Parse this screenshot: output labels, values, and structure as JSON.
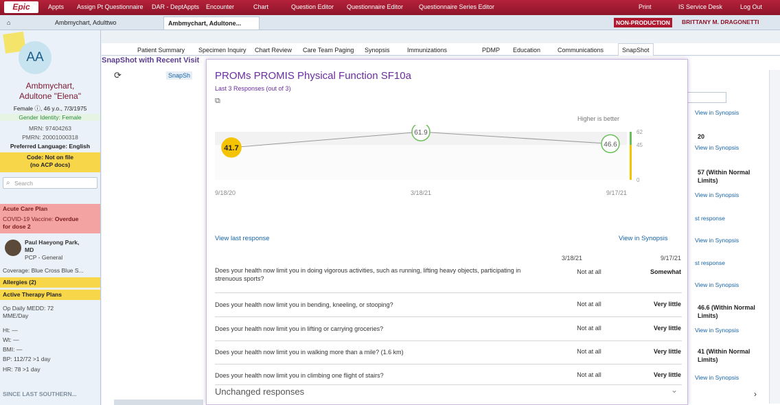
{
  "topbar": {
    "brand": "Epic",
    "items": [
      "Appts",
      "Assign Pt Questionnaire",
      "DAR - DeptAppts",
      "Encounter",
      "Chart",
      "Question Editor",
      "Questionnaire Editor",
      "Questionnaire Series Editor"
    ],
    "right": [
      "Print",
      "IS Service Desk",
      "Log Out"
    ]
  },
  "window_tabs": [
    "Ambmychart, Adulttwo",
    "Ambmychart, Adultone..."
  ],
  "environment_badge": "NON-PRODUCTION",
  "user_name": "BRITTANY M. DRAGONETTI",
  "patient": {
    "initials": "AA",
    "name_line1": "Ambmychart,",
    "name_line2": "Adultone \"Elena\"",
    "demographics": "Female ⓘ, 46 y.o., 7/3/1975",
    "gender_identity": "Gender Identity: Female",
    "mrn": "MRN: 97404263",
    "pmrn": "PMRN: 20001000318",
    "language": "Preferred Language: English",
    "code_line1": "Code: Not on file",
    "code_line2": "(no ACP docs)",
    "search_placeholder": "Search",
    "acute_care": "Acute Care Plan",
    "covid_label": "COVID-19 Vaccine:",
    "covid_status": "Overdue",
    "covid_dose": "for dose 2",
    "pcp_line1": "Paul Haeyong Park,",
    "pcp_line2": "MD",
    "pcp_role": "PCP - General",
    "coverage": "Coverage: Blue Cross Blue S...",
    "allergies": "Allergies (2)",
    "therapy": "Active Therapy Plans",
    "medd_line1": "Op Daily MEDD: 72",
    "medd_line2": "MME/Day",
    "ht": "Ht: —",
    "wt": "Wt: —",
    "bmi": "BMI: —",
    "bp": "BP: 112/72 >1 day",
    "hr": "HR: 78 >1 day",
    "since": "SINCE LAST SOUTHERN..."
  },
  "activity_tabs": [
    "Patient Summary",
    "Specimen Inquiry",
    "Chart Review",
    "Care Team Paging",
    "Synopsis",
    "Immunizations",
    "PDMP",
    "Education",
    "Communications",
    "SnapShot"
  ],
  "work_title": "SnapShot with Recent Visit",
  "toolbar_label": "SnapSh",
  "popup": {
    "title": "PROMs PROMIS Physical Function SF10a",
    "subtitle": "Last 3 Responses (out of 3)",
    "higher_better": "Higher is better",
    "view_last": "View last response",
    "view_synopsis": "View in Synopsis",
    "unchanged": "Unchanged responses",
    "col_headers": [
      "3/18/21",
      "9/17/21"
    ],
    "questions": [
      {
        "q": "Does your health now limit you in doing vigorous activities, such as running, lifting heavy objects, participating in strenuous sports?",
        "a1": "Not at all",
        "a2": "Somewhat"
      },
      {
        "q": "Does your health now limit you in bending, kneeling, or stooping?",
        "a1": "Not at all",
        "a2": "Very little"
      },
      {
        "q": "Does your health now limit you in lifting or carrying groceries?",
        "a1": "Not at all",
        "a2": "Very little"
      },
      {
        "q": "Does your health now limit you in walking more than a mile? (1.6 km)",
        "a1": "Not at all",
        "a2": "Very little"
      },
      {
        "q": "Does your health now limit you in climbing one flight of stairs?",
        "a1": "Not at all",
        "a2": "Very little"
      }
    ]
  },
  "chart_data": {
    "type": "line",
    "x": [
      "9/18/20",
      "3/18/21",
      "9/17/21"
    ],
    "values": [
      41.7,
      61.9,
      46.6
    ],
    "y_ticks": [
      0,
      45,
      62
    ],
    "ylim": [
      0,
      62
    ],
    "band": [
      45,
      62
    ],
    "grid": false,
    "colors": {
      "line": "#999999",
      "first_point": "#f5c400",
      "other_points": "#6bbf5a",
      "band": "#f2f2f2"
    }
  },
  "right_panel": {
    "items": [
      {
        "type": "link",
        "text": "View in Synopsis"
      },
      {
        "type": "value",
        "text": "20"
      },
      {
        "type": "link",
        "text": "View in Synopsis"
      },
      {
        "type": "value",
        "text": "57 (Within Normal Limits)"
      },
      {
        "type": "link",
        "text": "View in Synopsis"
      },
      {
        "type": "link",
        "text": "st response"
      },
      {
        "type": "link",
        "text": "View in Synopsis"
      },
      {
        "type": "link",
        "text": "st response"
      },
      {
        "type": "link",
        "text": "View in Synopsis"
      },
      {
        "type": "value",
        "text": "46.6 (Within Normal Limits)"
      },
      {
        "type": "link",
        "text": "View in Synopsis"
      },
      {
        "type": "value",
        "text": "41 (Within Normal Limits)"
      },
      {
        "type": "link",
        "text": "View in Synopsis"
      }
    ]
  }
}
